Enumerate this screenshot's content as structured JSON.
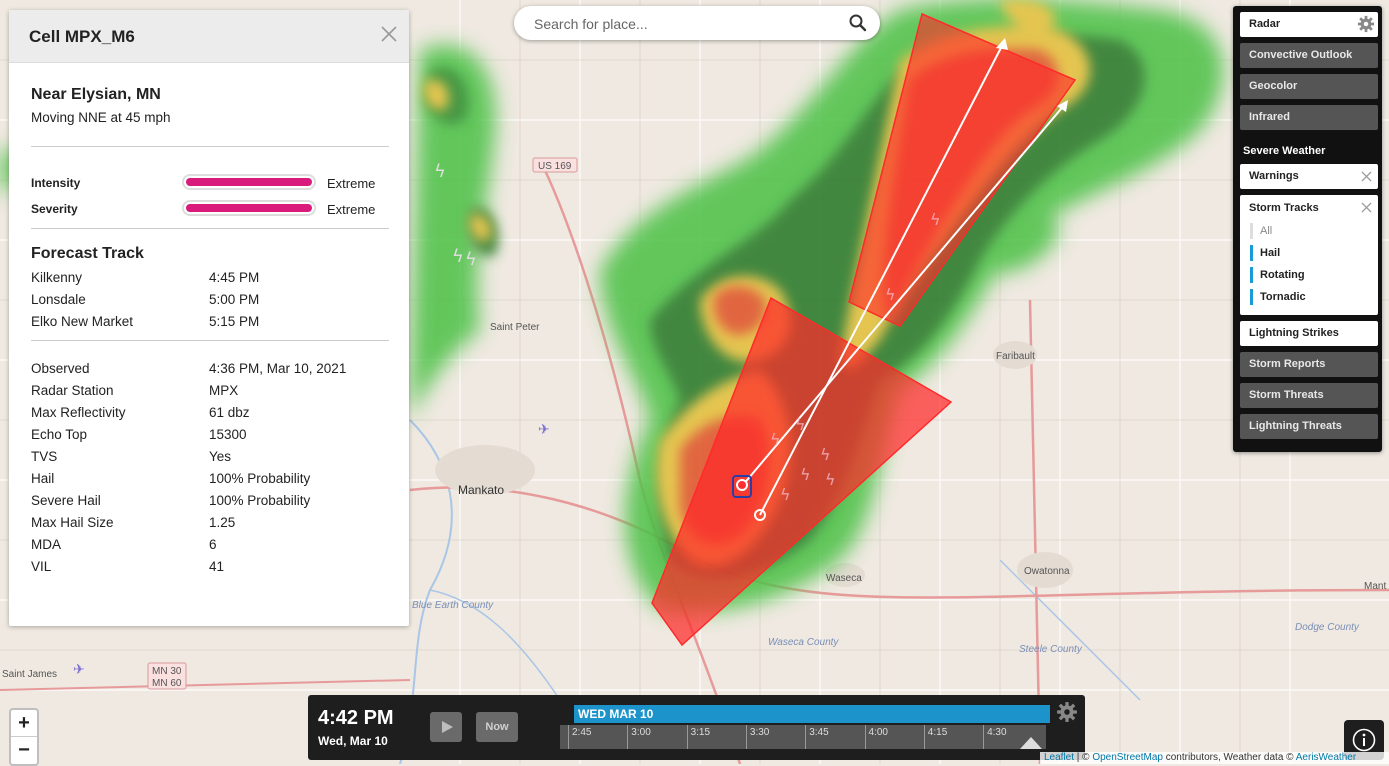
{
  "search": {
    "placeholder": "Search for place..."
  },
  "panel": {
    "title": "Cell MPX_M6",
    "location": "Near Elysian, MN",
    "movement": "Moving NNE at 45 mph",
    "meters": [
      {
        "label": "Intensity",
        "value": "Extreme",
        "level": 1.0
      },
      {
        "label": "Severity",
        "value": "Extreme",
        "level": 1.0
      }
    ],
    "forecast_title": "Forecast Track",
    "forecast": [
      {
        "place": "Kilkenny",
        "time": "4:45 PM"
      },
      {
        "place": "Lonsdale",
        "time": "5:00 PM"
      },
      {
        "place": "Elko New Market",
        "time": "5:15 PM"
      }
    ],
    "details": [
      {
        "k": "Observed",
        "v": "4:36 PM, Mar 10, 2021"
      },
      {
        "k": "Radar Station",
        "v": "MPX"
      },
      {
        "k": "Max Reflectivity",
        "v": "61 dbz"
      },
      {
        "k": "Echo Top",
        "v": "15300"
      },
      {
        "k": "TVS",
        "v": "Yes"
      },
      {
        "k": "Hail",
        "v": "100% Probability"
      },
      {
        "k": "Severe Hail",
        "v": "100% Probability"
      },
      {
        "k": "Max Hail Size",
        "v": "1.25"
      },
      {
        "k": "MDA",
        "v": "6"
      },
      {
        "k": "VIL",
        "v": "41"
      }
    ]
  },
  "layers": {
    "radar": "Radar",
    "convective": "Convective Outlook",
    "geocolor": "Geocolor",
    "infrared": "Infrared",
    "severe_title": "Severe Weather",
    "warnings": "Warnings",
    "storm_tracks": "Storm Tracks",
    "storm_tracks_items": [
      "All",
      "Hail",
      "Rotating",
      "Tornadic"
    ],
    "lightning_strikes": "Lightning Strikes",
    "storm_reports": "Storm Reports",
    "storm_threats": "Storm Threats",
    "lightning_threats": "Lightning Threats"
  },
  "map": {
    "roads": [
      "US 169",
      "MN 30",
      "MN 60"
    ],
    "cities": [
      "Mankato",
      "Saint Peter",
      "Faribault",
      "Waseca",
      "Owatonna",
      "Saint James",
      "Mant"
    ],
    "counties": [
      "Blue Earth County",
      "Waseca County",
      "Steele County",
      "Dodge County"
    ]
  },
  "timeline": {
    "time": "4:42 PM",
    "date": "Wed, Mar 10",
    "now_label": "Now",
    "day_label": "WED MAR 10",
    "ticks": [
      "2:45",
      "3:00",
      "3:15",
      "3:30",
      "3:45",
      "4:00",
      "4:15",
      "4:30"
    ]
  },
  "zoom": {
    "in": "+",
    "out": "−"
  },
  "attribution": {
    "leaflet": "Leaflet",
    "sep": " | © ",
    "osm": "OpenStreetMap",
    "mid": " contributors, Weather data © ",
    "aeris": "AerisWeather"
  },
  "colors": {
    "magenta": "#d81b7d",
    "accent": "#1d93cc",
    "storm_red": "#ff2a2a"
  }
}
